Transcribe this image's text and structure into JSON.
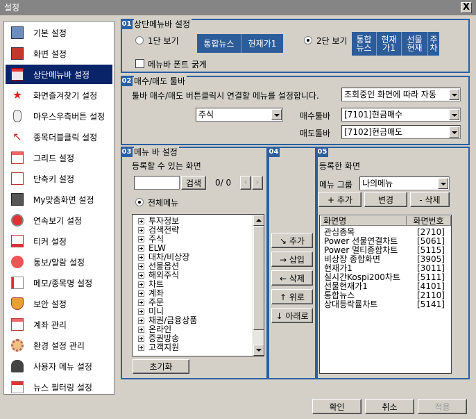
{
  "window": {
    "title": "설정",
    "close": "X"
  },
  "sidebar": {
    "items": [
      {
        "label": "기본 설정",
        "icon": "monitor-icon",
        "active": false
      },
      {
        "label": "화면 설정",
        "icon": "monitor-red-icon",
        "active": false
      },
      {
        "label": "상단메뉴바 설정",
        "icon": "menubar-icon",
        "active": true
      },
      {
        "label": "화면즐겨찾기 설정",
        "icon": "star-icon",
        "active": false
      },
      {
        "label": "마우스우측버튼 설정",
        "icon": "mouse-icon",
        "active": false
      },
      {
        "label": "종목더블클릭 설정",
        "icon": "cursor-icon",
        "active": false
      },
      {
        "label": "그리드 설정",
        "icon": "grid-icon",
        "active": false
      },
      {
        "label": "단축키 설정",
        "icon": "hotkey-icon",
        "active": false
      },
      {
        "label": "My맞춤화면 설정",
        "icon": "custom-screen-icon",
        "active": false
      },
      {
        "label": "연속보기 설정",
        "icon": "magnifier-icon",
        "active": false
      },
      {
        "label": "티커 설정",
        "icon": "ticker-icon",
        "active": false
      },
      {
        "label": "통보/알람 설정",
        "icon": "alarm-icon",
        "active": false
      },
      {
        "label": "메모/종목명 설정",
        "icon": "memo-icon",
        "active": false
      },
      {
        "label": "보안 설정",
        "icon": "shield-icon",
        "active": false
      },
      {
        "label": "계좌 관리",
        "icon": "account-icon",
        "active": false
      },
      {
        "label": "환경 설정 관리",
        "icon": "gear-icon",
        "active": false
      },
      {
        "label": "사용자 메뉴 설정",
        "icon": "user-menu-icon",
        "active": false
      },
      {
        "label": "뉴스 필터링 설정",
        "icon": "news-icon",
        "active": false
      }
    ]
  },
  "section01": {
    "badge": "01",
    "title": "상단메뉴바 설정",
    "one_line": "1단 보기",
    "one_line_items": [
      "통합뉴스",
      "현재가1"
    ],
    "two_line": "2단 보기",
    "two_line_items": [
      [
        "통합",
        "뉴스"
      ],
      [
        "현재",
        "가1"
      ],
      [
        "선물",
        "현재"
      ],
      [
        "주",
        "차"
      ]
    ],
    "bold_font": "메뉴바 폰트 굵게"
  },
  "section02": {
    "badge": "02",
    "title": "매수/매도 툴바",
    "description": "툴바 매수/매도 버튼클릭시 연결할 메뉴를 설정합니다.",
    "mode_select": "조회중인 화면에 따라 자동",
    "market_select": "주식",
    "buy_label": "매수툴바",
    "buy_select": "[7101]현금매수",
    "sell_label": "매도툴바",
    "sell_select": "[7102]현금매도"
  },
  "section03": {
    "badge": "03",
    "title": "메뉴 바 설정",
    "subtitle": "등록할 수 있는 화면",
    "search_btn": "검색",
    "counter": "0/ 0",
    "all_menu": "전체메뉴",
    "tree": [
      "투자정보",
      "검색전략",
      "주식",
      "ELW",
      "대차/비상장",
      "선물옵션",
      "해외주식",
      "차트",
      "계좌",
      "주문",
      "미니",
      "채권/금융상품",
      "온라인",
      "증권방송",
      "고객지원"
    ],
    "reset_btn": "초기화"
  },
  "section04": {
    "badge": "04",
    "add": "↘ 추가",
    "insert": "→ 삽입",
    "delete": "← 삭제",
    "up": "↑ 위로",
    "down": "↓ 아래로"
  },
  "section05": {
    "badge": "05",
    "title": "등록한 화면",
    "group_label": "메뉴 그룹",
    "group_select": "나의메뉴",
    "add_btn": "+ 추가",
    "edit_btn": "변경",
    "del_btn": "- 삭제",
    "col_name": "화면명",
    "col_code": "화면번호",
    "rows": [
      {
        "name": "관심종목",
        "code": "[2710]"
      },
      {
        "name": "Power 선물연결차트",
        "code": "[5061]"
      },
      {
        "name": "Power 멀티종합차트",
        "code": "[5115]"
      },
      {
        "name": "비상장 종합화면",
        "code": "[3905]"
      },
      {
        "name": "현재가1",
        "code": "[3011]"
      },
      {
        "name": "실시간Kospi200차트",
        "code": "[5111]"
      },
      {
        "name": "선물현재가1",
        "code": "[4101]"
      },
      {
        "name": "통합뉴스",
        "code": "[2110]"
      },
      {
        "name": "상대등락률차트",
        "code": "[5141]"
      }
    ]
  },
  "footer": {
    "ok": "확인",
    "cancel": "취소",
    "apply": "적용"
  }
}
